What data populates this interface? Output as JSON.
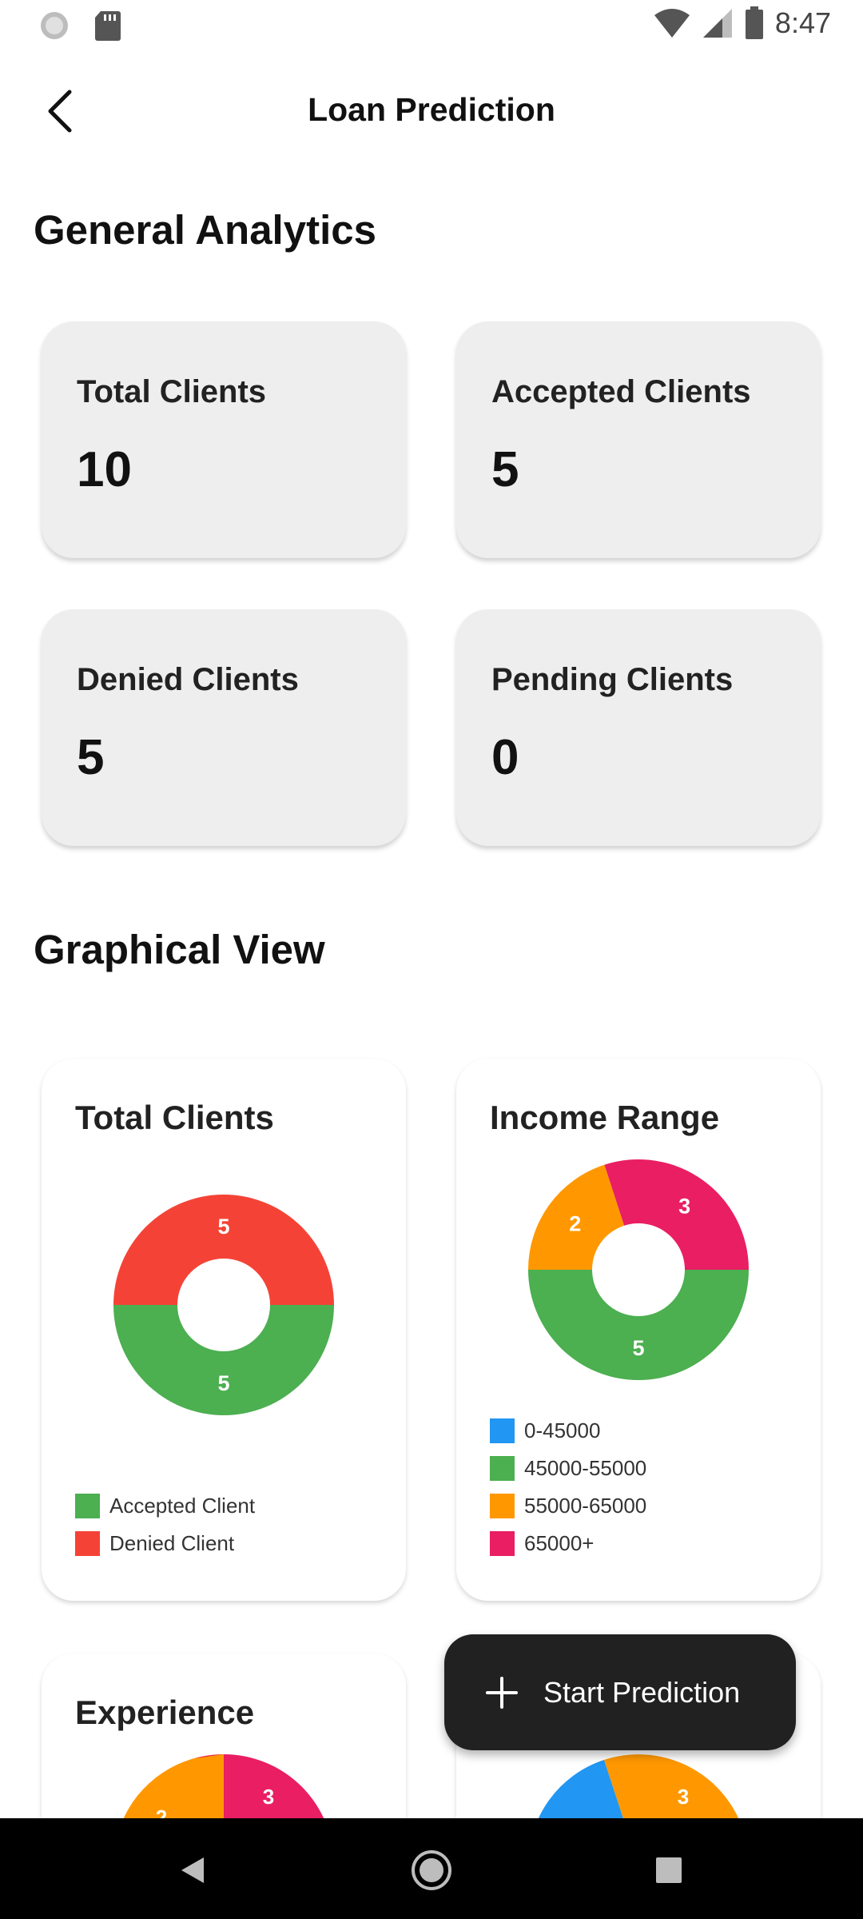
{
  "status_bar": {
    "time": "8:47"
  },
  "app_bar": {
    "title": "Loan Prediction"
  },
  "sections": {
    "general": "General Analytics",
    "graphical": "Graphical View"
  },
  "stats": [
    {
      "label": "Total Clients",
      "value": "10"
    },
    {
      "label": "Accepted Clients",
      "value": "5"
    },
    {
      "label": "Denied Clients",
      "value": "5"
    },
    {
      "label": "Pending Clients",
      "value": "0"
    }
  ],
  "colors": {
    "accepted": "#4CAF50",
    "denied": "#F44336",
    "blue": "#2196F3",
    "green": "#4CAF50",
    "orange": "#FF9800",
    "pink": "#E91E63"
  },
  "chart_data": [
    {
      "type": "pie",
      "title": "Total Clients",
      "categories": [
        "Accepted Client",
        "Denied Client"
      ],
      "values": [
        5,
        5
      ],
      "colors": [
        "#4CAF50",
        "#F44336"
      ],
      "legend": "bottom"
    },
    {
      "type": "pie",
      "title": "Income Range",
      "categories": [
        "0-45000",
        "45000-55000",
        "55000-65000",
        "65000+"
      ],
      "values": [
        0,
        5,
        2,
        3
      ],
      "colors": [
        "#2196F3",
        "#4CAF50",
        "#FF9800",
        "#E91E63"
      ],
      "legend": "bottom"
    },
    {
      "type": "pie",
      "title": "Experience",
      "slice_labels": [
        "2",
        "3"
      ],
      "colors": [
        "#FF9800",
        "#E91E63"
      ]
    },
    {
      "type": "pie",
      "slice_labels": [
        "3"
      ],
      "colors": [
        "#2196F3",
        "#FF9800"
      ]
    }
  ],
  "fab": {
    "label": "Start Prediction"
  }
}
